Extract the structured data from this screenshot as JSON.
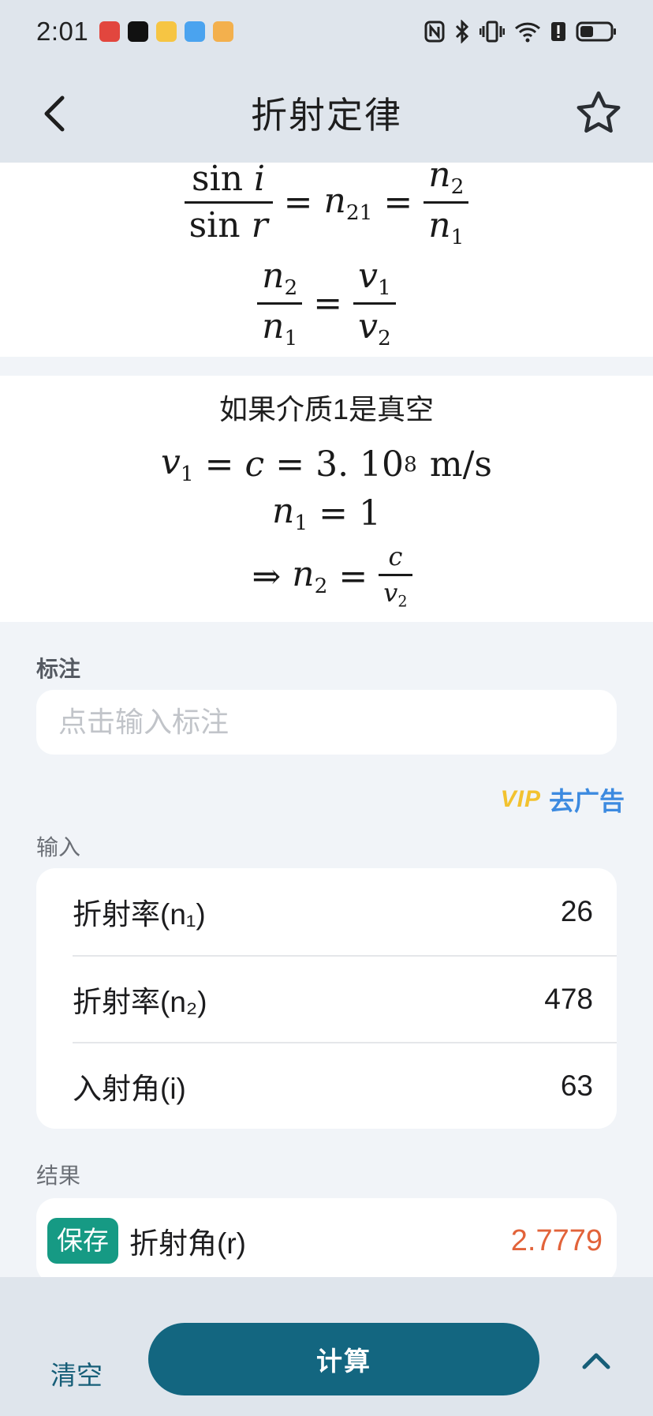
{
  "status_bar": {
    "time": "2:01"
  },
  "header": {
    "title": "折射定律"
  },
  "formulas": {
    "ratio": {
      "sin": "sin",
      "i": "i",
      "r": "r",
      "n": "n",
      "sub21": "21",
      "sub1": "1",
      "sub2": "2",
      "equals": "="
    },
    "velocity": {
      "n": "n",
      "v": "v",
      "sub1": "1",
      "sub2": "2",
      "equals": "="
    },
    "vacuum": {
      "heading": "如果介质1是真空",
      "v": "v",
      "c": "c",
      "n": "n",
      "sub1": "1",
      "sub2": "2",
      "speed": "3. 10",
      "exp": "8",
      "unit": "m/s",
      "one": "1",
      "implies": "⇒",
      "equals": "="
    }
  },
  "note": {
    "label": "标注",
    "placeholder": "点击输入标注"
  },
  "ad": {
    "vip": "VIP",
    "text": "去广告"
  },
  "input": {
    "label": "输入",
    "rows": [
      {
        "label": "折射率(n₁)",
        "value": "26"
      },
      {
        "label": "折射率(n₂)",
        "value": "478"
      },
      {
        "label": "入射角(i)",
        "value": "63"
      }
    ]
  },
  "result": {
    "label": "结果",
    "save": "保存",
    "name": "折射角(r)",
    "value": "2.7779"
  },
  "bottom": {
    "clear": "清空",
    "calculate": "计算"
  },
  "colors": {
    "accent": "#136680",
    "save": "#169a84",
    "result": "#e2633a",
    "vip": "#f2c230",
    "link": "#3c8ae0"
  }
}
